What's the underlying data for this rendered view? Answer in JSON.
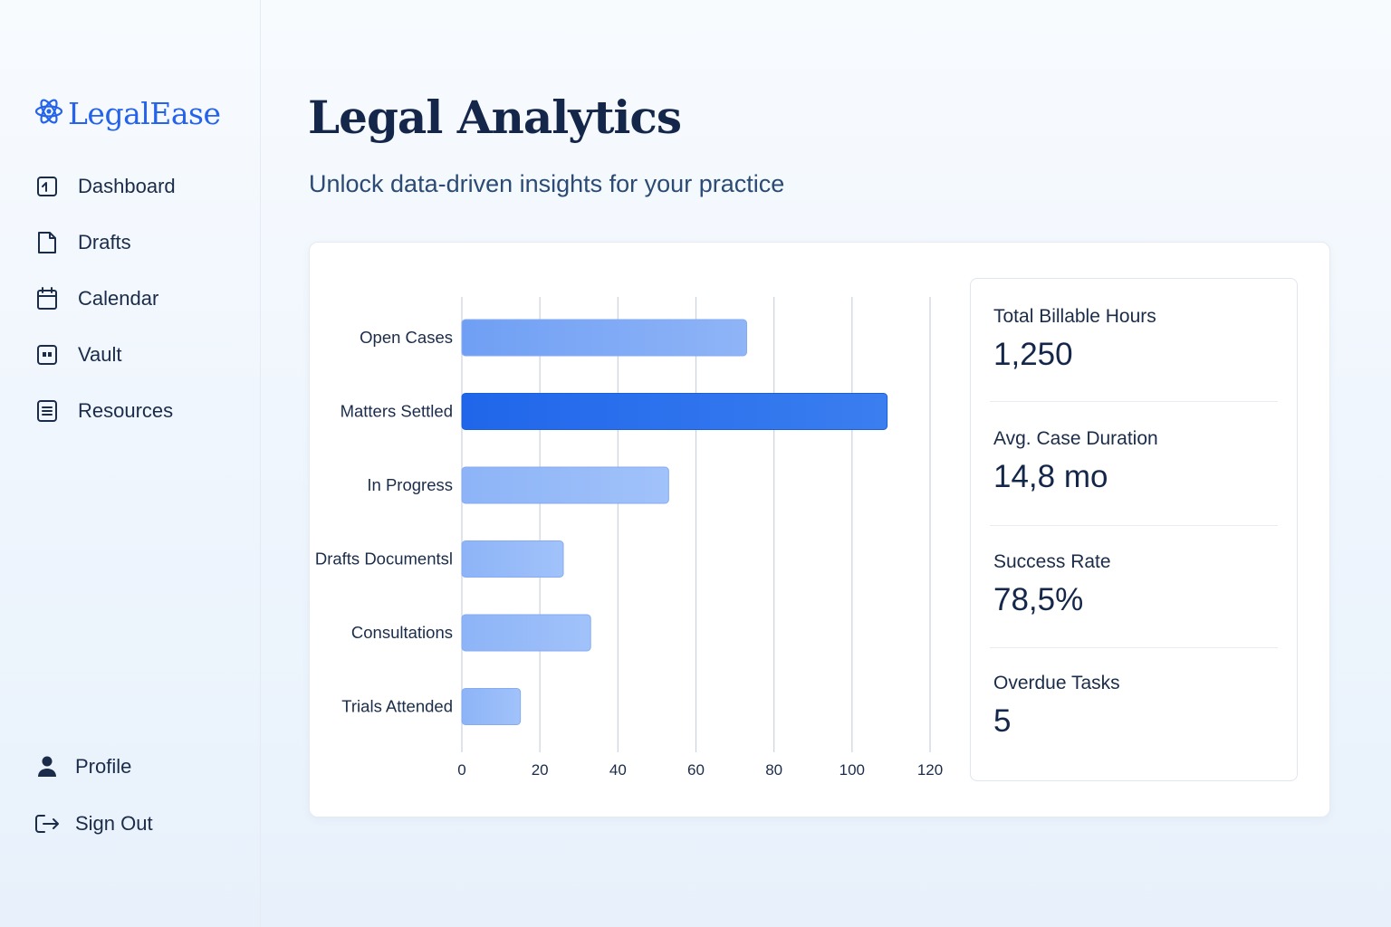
{
  "brand": {
    "name": "LegalEase",
    "icon": "atom-icon"
  },
  "sidebar": {
    "items": [
      {
        "label": "Dashboard",
        "icon": "dashboard-icon"
      },
      {
        "label": "Drafts",
        "icon": "document-icon"
      },
      {
        "label": "Calendar",
        "icon": "calendar-icon"
      },
      {
        "label": "Vault",
        "icon": "vault-icon"
      },
      {
        "label": "Resources",
        "icon": "list-document-icon"
      }
    ],
    "bottom_items": [
      {
        "label": "Profile",
        "icon": "user-icon"
      },
      {
        "label": "Sign Out",
        "icon": "sign-out-icon"
      }
    ]
  },
  "header": {
    "title": "Legal Analytics",
    "subtitle": "Unlock data-driven insights for your practice"
  },
  "chart_data": {
    "type": "bar",
    "orientation": "horizontal",
    "categories": [
      "Open Cases",
      "Matters Settled",
      "In Progress",
      "Drafts Documentsl",
      "Consultations",
      "Trials Attended"
    ],
    "values": [
      73,
      109,
      53,
      26,
      33,
      15
    ],
    "highlighted": "Matters Settled",
    "xlim": [
      0,
      120
    ],
    "xticks": [
      0,
      20,
      40,
      60,
      80,
      100,
      120
    ],
    "grid": true,
    "colors": {
      "bar": "#91b6f8",
      "highlight": "#2563eb"
    }
  },
  "stats": [
    {
      "label": "Total Billable Hours",
      "value": "1,250"
    },
    {
      "label": "Avg. Case Duration",
      "value": "14,8 mo"
    },
    {
      "label": "Success Rate",
      "value": "78,5%"
    },
    {
      "label": "Overdue Tasks",
      "value": "5"
    }
  ],
  "colors": {
    "accent": "#2563eb",
    "text_dark": "#14264a"
  }
}
